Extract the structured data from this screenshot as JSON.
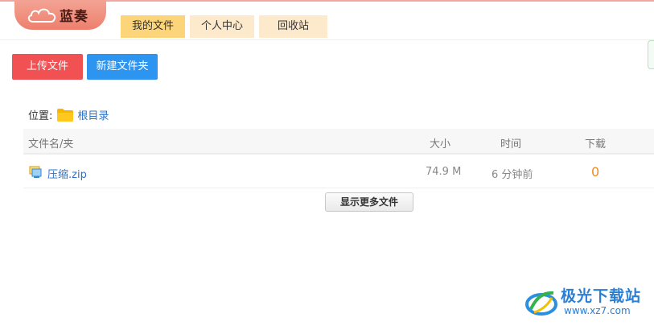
{
  "brand": {
    "name": "蓝奏",
    "logo_icon": "cloud-icon"
  },
  "nav": {
    "tabs": [
      {
        "label": "我的文件",
        "active": true
      },
      {
        "label": "个人中心",
        "active": false
      },
      {
        "label": "回收站",
        "active": false
      }
    ]
  },
  "toolbar": {
    "upload_label": "上传文件",
    "new_folder_label": "新建文件夹"
  },
  "location": {
    "label": "位置:",
    "folder_icon": "folder-icon",
    "root_label": "根目录"
  },
  "table": {
    "headers": {
      "name": "文件名/夹",
      "size": "大小",
      "time": "时间",
      "downloads": "下载"
    },
    "rows": [
      {
        "icon": "zip-file-icon",
        "name": "压缩.zip",
        "size": "74.9 M",
        "time": "6 分钟前",
        "downloads": "0"
      }
    ]
  },
  "more_button_label": "显示更多文件",
  "watermark": {
    "title": "极光下载站",
    "url": "www.xz7.com"
  },
  "colors": {
    "upload": "#f25153",
    "new_folder": "#2d95f0",
    "active_tab": "#fcd47a",
    "inactive_tab": "#fde9cc",
    "link": "#2b72c9",
    "downloads": "#f08a24"
  }
}
